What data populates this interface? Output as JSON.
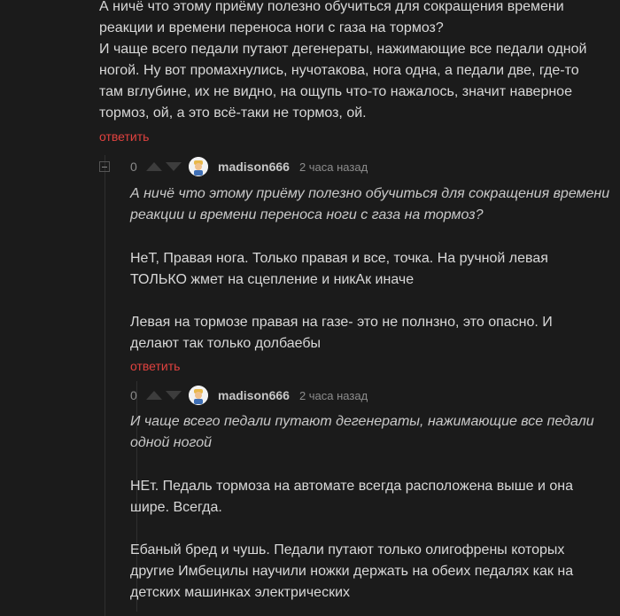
{
  "parent_comment": {
    "lines": [
      "А ничё что этому приёму полезно обучиться для сокращения времени",
      "реакции и времени переноса ноги с газа на тормоз?",
      "И чаще всего педали путают дегенераты, нажимающие все педали одной",
      "ногой. Ну вот промахнулись, нучотакова, нога одна, а педали две, где-то",
      "там вглубине, их не видно, на ощупь что-то нажалось, значит наверное",
      "тормоз, ой, а это всё-таки не тормоз, ой."
    ],
    "reply_label": "ответить"
  },
  "comments": [
    {
      "rating": "0",
      "username": "madison666",
      "time": "2 часа назад",
      "quote_lines": [
        "А ничё что этому приёму полезно обучиться для сокращения времени",
        "реакции и времени переноса ноги с газа на тормоз?"
      ],
      "body_lines": [
        "НеТ, Правая нога. Только правая и все, точка. На ручной левая",
        "ТОЛЬКО жмет на сцепление и никАк иначе",
        "",
        "Левая на тормозе правая на газе- это не полнзно, это опасно. И",
        "делают так только долбаебы"
      ],
      "reply_label": "ответить"
    },
    {
      "rating": "0",
      "username": "madison666",
      "time": "2 часа назад",
      "quote_lines": [
        "И чаще всего педали путают дегенераты, нажимающие все педали",
        "одной ногой"
      ],
      "body_lines": [
        "НЕт. Педаль тормоза на автомате всегда расположена выше и она",
        "шире. Всегда.",
        "",
        "Ебаный бред и чушь. Педали путают только олигофрены которых",
        "другие Имбецилы научили ножки держать на обеих педалях как на",
        "детских машинках электрических"
      ]
    }
  ],
  "icons": {
    "upvote": "arrow-up-icon",
    "downvote": "arrow-down-icon",
    "collapse": "collapse-minus-icon"
  },
  "colors": {
    "background": "#1b1b1b",
    "text": "#d8d8d8",
    "accent": "#e0423f",
    "muted": "#8d8d8d"
  }
}
